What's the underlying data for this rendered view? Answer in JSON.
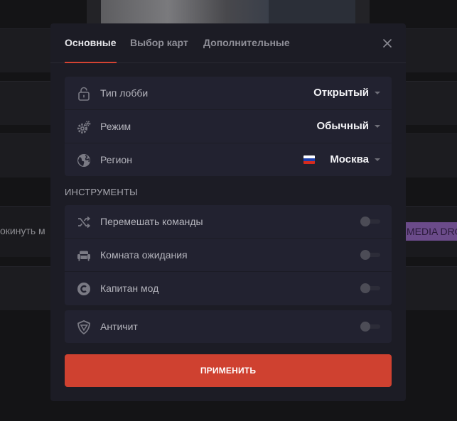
{
  "background": {
    "left_text": "окинуть м",
    "right_badge": "MEDIA DRO"
  },
  "modal": {
    "tabs": [
      {
        "label": "Основные",
        "active": true
      },
      {
        "label": "Выбор карт",
        "active": false
      },
      {
        "label": "Дополнительные",
        "active": false
      }
    ],
    "settings": [
      {
        "label": "Тип лобби",
        "value": "Открытый",
        "icon": "lock-icon"
      },
      {
        "label": "Режим",
        "value": "Обычный",
        "icon": "gears-icon"
      },
      {
        "label": "Регион",
        "value": "Москва",
        "icon": "globe-icon",
        "flag": "russia-flag"
      }
    ],
    "tools_title": "ИНСТРУМЕНТЫ",
    "tools": [
      {
        "label": "Перемешать команды",
        "icon": "shuffle-icon",
        "enabled": false
      },
      {
        "label": "Комната ожидания",
        "icon": "sofa-icon",
        "enabled": false
      },
      {
        "label": "Капитан мод",
        "icon": "captain-icon",
        "enabled": false
      }
    ],
    "anticheat": {
      "label": "Античит",
      "icon": "shield-icon",
      "enabled": false
    },
    "apply_label": "ПРИМЕНИТЬ"
  },
  "colors": {
    "accent": "#d44332",
    "apply_button": "#cf4130",
    "modal_bg": "#1c1c25",
    "section_bg": "#222230"
  }
}
